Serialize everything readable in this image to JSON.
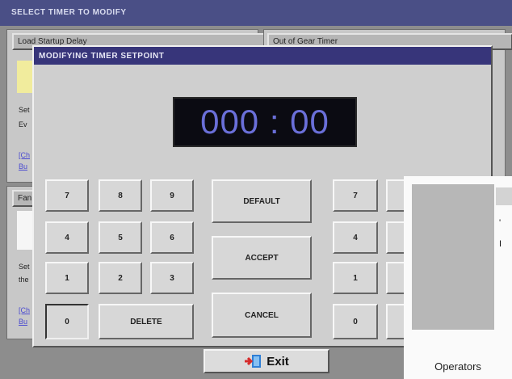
{
  "outer": {
    "title": "SELECT TIMER TO MODIFY",
    "panels": [
      {
        "title": "Load Startup Delay",
        "line1": "Set",
        "line2": "Ev",
        "link1": "[Ch",
        "link2": "Bu"
      },
      {
        "title": "Out of Gear Timer"
      },
      {
        "title": "Fan",
        "line1": "Set",
        "line2": "the",
        "link1": "[Ch",
        "link2": "Bu"
      }
    ]
  },
  "dialog": {
    "title": "MODIFYING TIMER SETPOINT",
    "display_value": "000 : 00",
    "keypad": [
      "7",
      "8",
      "9",
      "4",
      "5",
      "6",
      "1",
      "2",
      "3",
      "0"
    ],
    "delete_label": "DELETE",
    "actions": {
      "default": "DEFAULT",
      "accept": "ACCEPT",
      "cancel": "CANCEL"
    },
    "right_keys": [
      "7",
      "4",
      "1",
      "0"
    ]
  },
  "exit_label": "Exit",
  "inset": {
    "label": "Operators",
    "glyph1": "'",
    "glyph2": "I"
  }
}
